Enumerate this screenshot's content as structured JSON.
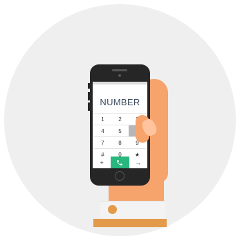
{
  "screen": {
    "title": "NUMBER",
    "keys": [
      [
        "1",
        "2",
        "3"
      ],
      [
        "4",
        "5",
        ""
      ],
      [
        "7",
        "8",
        "9"
      ],
      [
        "#",
        "0",
        "★"
      ]
    ],
    "bottom": {
      "left": "+",
      "call_icon": "phone-icon",
      "right": "→"
    }
  },
  "colors": {
    "background_circle": "#efefef",
    "skin": "#f6a36c",
    "cuff": "#f3f3f3",
    "cuff_accent": "#e39a4a",
    "phone_body": "#262626",
    "call_green": "#28b77c",
    "title_text": "#3c4b5c"
  }
}
